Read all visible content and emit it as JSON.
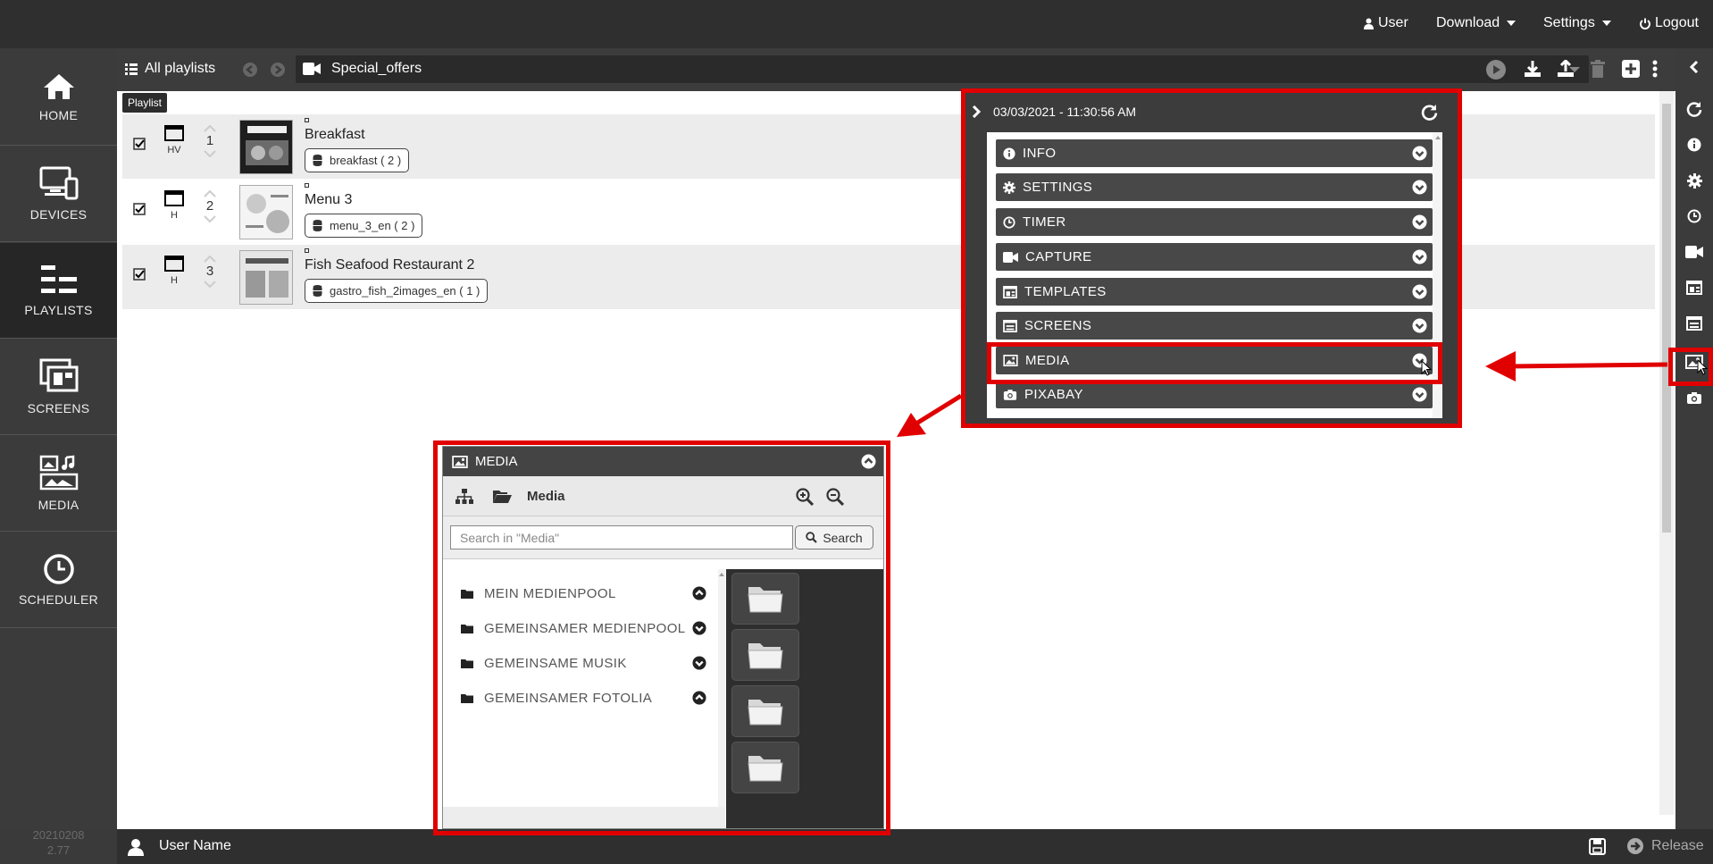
{
  "topbar": {
    "user_label": "User",
    "download_label": "Download",
    "settings_label": "Settings",
    "logout_label": "Logout"
  },
  "sidebar": {
    "items": [
      {
        "label": "HOME",
        "icon": "home-icon"
      },
      {
        "label": "DEVICES",
        "icon": "devices-icon"
      },
      {
        "label": "PLAYLISTS",
        "icon": "playlists-icon",
        "active": true
      },
      {
        "label": "SCREENS",
        "icon": "screens-icon"
      },
      {
        "label": "MEDIA",
        "icon": "media-icon"
      },
      {
        "label": "SCHEDULER",
        "icon": "scheduler-icon"
      }
    ],
    "version_line1": "20210208",
    "version_line2": "2.77"
  },
  "toolbar": {
    "all_playlists_label": "All playlists",
    "current_playlist": "Special_offers",
    "tooltip": "Playlist"
  },
  "playlist": {
    "rows": [
      {
        "checked": true,
        "orientation": "HV",
        "number": "1",
        "name": "Breakfast",
        "datasource": "breakfast ( 2 )"
      },
      {
        "checked": true,
        "orientation": "H",
        "number": "2",
        "name": "Menu 3",
        "datasource": "menu_3_en ( 2 )"
      },
      {
        "checked": true,
        "orientation": "H",
        "number": "3",
        "name": "Fish Seafood Restaurant 2",
        "datasource": "gastro_fish_2images_en ( 1 )"
      }
    ]
  },
  "panel": {
    "timestamp": "03/03/2021 - 11:30:56 AM",
    "sections": [
      {
        "label": "INFO",
        "icon": "info-icon"
      },
      {
        "label": "SETTINGS",
        "icon": "gear-icon"
      },
      {
        "label": "TIMER",
        "icon": "clock-icon"
      },
      {
        "label": "CAPTURE",
        "icon": "video-camera-icon"
      },
      {
        "label": "TEMPLATES",
        "icon": "templates-icon"
      },
      {
        "label": "SCREENS",
        "icon": "screens-icon"
      },
      {
        "label": "MEDIA",
        "icon": "image-icon"
      },
      {
        "label": "PIXABAY",
        "icon": "camera-icon"
      }
    ]
  },
  "media": {
    "title": "MEDIA",
    "path_label": "Media",
    "search_placeholder": "Search in \"Media\"",
    "search_button": "Search",
    "folders": [
      {
        "label": "MEIN MEDIENPOOL",
        "expanded": true
      },
      {
        "label": "GEMEINSAMER MEDIENPOOL",
        "expanded": false
      },
      {
        "label": "GEMEINSAME MUSIK",
        "expanded": false
      },
      {
        "label": "GEMEINSAMER FOTOLIA",
        "expanded": true
      }
    ]
  },
  "bottombar": {
    "user_name": "User Name",
    "release_label": "Release"
  },
  "colors": {
    "highlight": "#e00000",
    "dark_bar": "#2f2f2f",
    "panel": "#3c3c3c"
  }
}
